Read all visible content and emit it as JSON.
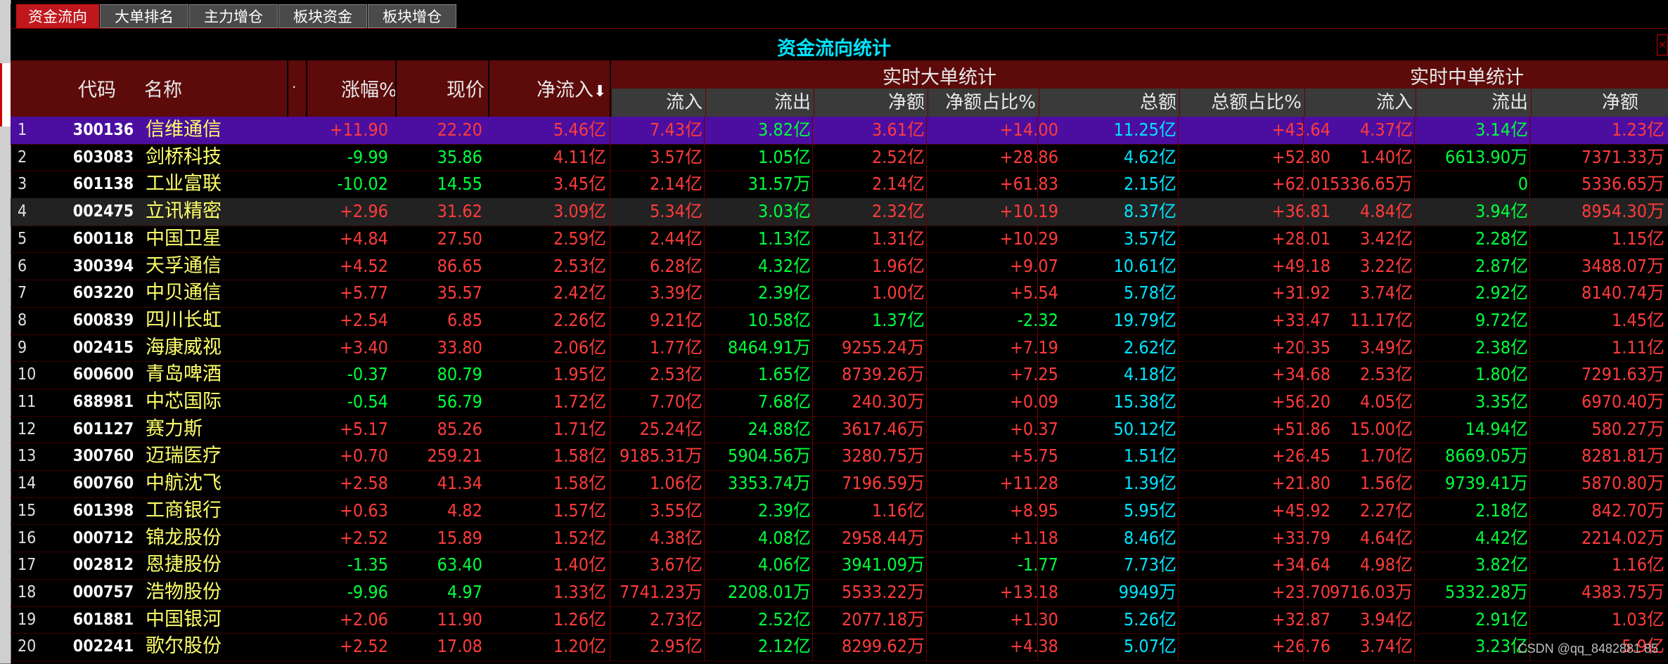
{
  "tabs": [
    "资金流向",
    "大单排名",
    "主力增仓",
    "板块资金",
    "板块增仓"
  ],
  "title": "资金流向统计",
  "header": {
    "code": "代码",
    "name": "名称",
    "dot": ".",
    "change": "涨幅%",
    "price": "现价",
    "net_inflow": "净流入",
    "big_group": "实时大单统计",
    "mid_group": "实时中单统计",
    "big_sub": [
      "流入",
      "流出",
      "净额",
      "净额占比%",
      "总额",
      "总额占比%"
    ],
    "mid_sub": [
      "流入",
      "流出",
      "净额"
    ]
  },
  "colors": {
    "red": "#ff3b3b",
    "green": "#00ff3c",
    "cyan": "#00e5ff",
    "name": "#ffff6a",
    "header_bg": "#5d0a0a",
    "selected": "#4b0ea0"
  },
  "rows": [
    {
      "idx": "1",
      "code": "300136",
      "name": "信维通信",
      "change": "+11.90",
      "price": "22.20",
      "net": "5.46亿",
      "b_in": "7.43亿",
      "b_out": "3.82亿",
      "b_net": "3.61亿",
      "b_ratio": "+14.00",
      "b_total": "11.25亿",
      "b_tratio": "+43.64",
      "m_in": "4.37亿",
      "m_out": "3.14亿",
      "m_net": "1.23亿"
    },
    {
      "idx": "2",
      "code": "603083",
      "name": "剑桥科技",
      "change": "-9.99",
      "price": "35.86",
      "net": "4.11亿",
      "b_in": "3.57亿",
      "b_out": "1.05亿",
      "b_net": "2.52亿",
      "b_ratio": "+28.86",
      "b_total": "4.62亿",
      "b_tratio": "+52.80",
      "m_in": "1.40亿",
      "m_out": "6613.90万",
      "m_net": "7371.33万"
    },
    {
      "idx": "3",
      "code": "601138",
      "name": "工业富联",
      "change": "-10.02",
      "price": "14.55",
      "net": "3.45亿",
      "b_in": "2.14亿",
      "b_out": "31.57万",
      "b_net": "2.14亿",
      "b_ratio": "+61.83",
      "b_total": "2.15亿",
      "b_tratio": "+62.01",
      "m_in": "5336.65万",
      "m_out": "0",
      "m_net": "5336.65万"
    },
    {
      "idx": "4",
      "code": "002475",
      "name": "立讯精密",
      "change": "+2.96",
      "price": "31.62",
      "net": "3.09亿",
      "b_in": "5.34亿",
      "b_out": "3.03亿",
      "b_net": "2.32亿",
      "b_ratio": "+10.19",
      "b_total": "8.37亿",
      "b_tratio": "+36.81",
      "m_in": "4.84亿",
      "m_out": "3.94亿",
      "m_net": "8954.30万"
    },
    {
      "idx": "5",
      "code": "600118",
      "name": "中国卫星",
      "change": "+4.84",
      "price": "27.50",
      "net": "2.59亿",
      "b_in": "2.44亿",
      "b_out": "1.13亿",
      "b_net": "1.31亿",
      "b_ratio": "+10.29",
      "b_total": "3.57亿",
      "b_tratio": "+28.01",
      "m_in": "3.42亿",
      "m_out": "2.28亿",
      "m_net": "1.15亿"
    },
    {
      "idx": "6",
      "code": "300394",
      "name": "天孚通信",
      "change": "+4.52",
      "price": "86.65",
      "net": "2.53亿",
      "b_in": "6.28亿",
      "b_out": "4.32亿",
      "b_net": "1.96亿",
      "b_ratio": "+9.07",
      "b_total": "10.61亿",
      "b_tratio": "+49.18",
      "m_in": "3.22亿",
      "m_out": "2.87亿",
      "m_net": "3488.07万"
    },
    {
      "idx": "7",
      "code": "603220",
      "name": "中贝通信",
      "change": "+5.77",
      "price": "35.57",
      "net": "2.42亿",
      "b_in": "3.39亿",
      "b_out": "2.39亿",
      "b_net": "1.00亿",
      "b_ratio": "+5.54",
      "b_total": "5.78亿",
      "b_tratio": "+31.92",
      "m_in": "3.74亿",
      "m_out": "2.92亿",
      "m_net": "8140.74万"
    },
    {
      "idx": "8",
      "code": "600839",
      "name": "四川长虹",
      "change": "+2.54",
      "price": "6.85",
      "net": "2.26亿",
      "b_in": "9.21亿",
      "b_out": "10.58亿",
      "b_net": "1.37亿",
      "b_ratio": "-2.32",
      "b_total": "19.79亿",
      "b_tratio": "+33.47",
      "m_in": "11.17亿",
      "m_out": "9.72亿",
      "m_net": "1.45亿"
    },
    {
      "idx": "9",
      "code": "002415",
      "name": "海康威视",
      "change": "+3.40",
      "price": "33.80",
      "net": "2.06亿",
      "b_in": "1.77亿",
      "b_out": "8464.91万",
      "b_net": "9255.24万",
      "b_ratio": "+7.19",
      "b_total": "2.62亿",
      "b_tratio": "+20.35",
      "m_in": "3.49亿",
      "m_out": "2.38亿",
      "m_net": "1.11亿"
    },
    {
      "idx": "10",
      "code": "600600",
      "name": "青岛啤酒",
      "change": "-0.37",
      "price": "80.79",
      "net": "1.95亿",
      "b_in": "2.53亿",
      "b_out": "1.65亿",
      "b_net": "8739.26万",
      "b_ratio": "+7.25",
      "b_total": "4.18亿",
      "b_tratio": "+34.68",
      "m_in": "2.53亿",
      "m_out": "1.80亿",
      "m_net": "7291.63万"
    },
    {
      "idx": "11",
      "code": "688981",
      "name": "中芯国际",
      "change": "-0.54",
      "price": "56.79",
      "net": "1.72亿",
      "b_in": "7.70亿",
      "b_out": "7.68亿",
      "b_net": "240.30万",
      "b_ratio": "+0.09",
      "b_total": "15.38亿",
      "b_tratio": "+56.20",
      "m_in": "4.05亿",
      "m_out": "3.35亿",
      "m_net": "6970.40万"
    },
    {
      "idx": "12",
      "code": "601127",
      "name": "赛力斯",
      "change": "+5.17",
      "price": "85.26",
      "net": "1.71亿",
      "b_in": "25.24亿",
      "b_out": "24.88亿",
      "b_net": "3617.46万",
      "b_ratio": "+0.37",
      "b_total": "50.12亿",
      "b_tratio": "+51.86",
      "m_in": "15.00亿",
      "m_out": "14.94亿",
      "m_net": "580.27万"
    },
    {
      "idx": "13",
      "code": "300760",
      "name": "迈瑞医疗",
      "change": "+0.70",
      "price": "259.21",
      "net": "1.58亿",
      "b_in": "9185.31万",
      "b_out": "5904.56万",
      "b_net": "3280.75万",
      "b_ratio": "+5.75",
      "b_total": "1.51亿",
      "b_tratio": "+26.45",
      "m_in": "1.70亿",
      "m_out": "8669.05万",
      "m_net": "8281.81万"
    },
    {
      "idx": "14",
      "code": "600760",
      "name": "中航沈飞",
      "change": "+2.58",
      "price": "41.34",
      "net": "1.58亿",
      "b_in": "1.06亿",
      "b_out": "3353.74万",
      "b_net": "7196.59万",
      "b_ratio": "+11.28",
      "b_total": "1.39亿",
      "b_tratio": "+21.80",
      "m_in": "1.56亿",
      "m_out": "9739.41万",
      "m_net": "5870.80万"
    },
    {
      "idx": "15",
      "code": "601398",
      "name": "工商银行",
      "change": "+0.63",
      "price": "4.82",
      "net": "1.57亿",
      "b_in": "3.55亿",
      "b_out": "2.39亿",
      "b_net": "1.16亿",
      "b_ratio": "+8.95",
      "b_total": "5.95亿",
      "b_tratio": "+45.92",
      "m_in": "2.27亿",
      "m_out": "2.18亿",
      "m_net": "842.70万"
    },
    {
      "idx": "16",
      "code": "000712",
      "name": "锦龙股份",
      "change": "+2.52",
      "price": "15.89",
      "net": "1.52亿",
      "b_in": "4.38亿",
      "b_out": "4.08亿",
      "b_net": "2958.44万",
      "b_ratio": "+1.18",
      "b_total": "8.46亿",
      "b_tratio": "+33.79",
      "m_in": "4.64亿",
      "m_out": "4.42亿",
      "m_net": "2214.02万"
    },
    {
      "idx": "17",
      "code": "002812",
      "name": "恩捷股份",
      "change": "-1.35",
      "price": "63.40",
      "net": "1.40亿",
      "b_in": "3.67亿",
      "b_out": "4.06亿",
      "b_net": "3941.09万",
      "b_ratio": "-1.77",
      "b_total": "7.73亿",
      "b_tratio": "+34.64",
      "m_in": "4.98亿",
      "m_out": "3.82亿",
      "m_net": "1.16亿"
    },
    {
      "idx": "18",
      "code": "000757",
      "name": "浩物股份",
      "change": "-9.96",
      "price": "4.97",
      "net": "1.33亿",
      "b_in": "7741.23万",
      "b_out": "2208.01万",
      "b_net": "5533.22万",
      "b_ratio": "+13.18",
      "b_total": "9949万",
      "b_tratio": "+23.70",
      "m_in": "9716.03万",
      "m_out": "5332.28万",
      "m_net": "4383.75万"
    },
    {
      "idx": "19",
      "code": "601881",
      "name": "中国银河",
      "change": "+2.06",
      "price": "11.90",
      "net": "1.26亿",
      "b_in": "2.73亿",
      "b_out": "2.52亿",
      "b_net": "2077.18万",
      "b_ratio": "+1.30",
      "b_total": "5.26亿",
      "b_tratio": "+32.87",
      "m_in": "3.94亿",
      "m_out": "2.91亿",
      "m_net": "1.03亿"
    },
    {
      "idx": "20",
      "code": "002241",
      "name": "歌尔股份",
      "change": "+2.52",
      "price": "17.08",
      "net": "1.20亿",
      "b_in": "2.95亿",
      "b_out": "2.12亿",
      "b_net": "8299.62万",
      "b_ratio": "+4.38",
      "b_total": "5.07亿",
      "b_tratio": "+26.76",
      "m_in": "3.74亿",
      "m_out": "3.23亿",
      "m_net": "5.9亿"
    }
  ],
  "watermark": "CSDN @qq_8482881 85"
}
